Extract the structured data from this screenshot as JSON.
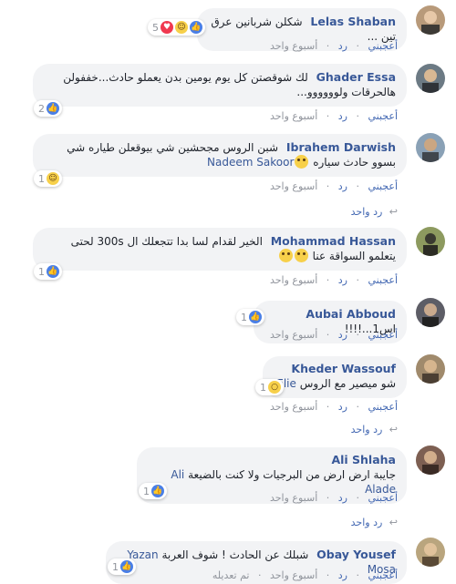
{
  "accent": "#385898",
  "link_color": "#4267b2",
  "actions": {
    "like": "أعجبني",
    "reply": "رد",
    "dot": "·",
    "edited": "تم تعديله"
  },
  "comments": [
    {
      "name": "Lelas Shaban",
      "text": "شكلن شربانين عرق تين ...",
      "time": "أسبوع واحد",
      "reactions": [
        "like",
        "haha",
        "love"
      ],
      "count": "5"
    },
    {
      "name": "Ghader Essa",
      "text": "لك شوقصتن كل يوم يومين بدن يعملو حادث...خففولن هالحرقات ولوووووو...",
      "time": "أسبوع واحد",
      "reactions": [
        "like"
      ],
      "count": "2"
    },
    {
      "name": "Ibrahem Darwish",
      "text": "شبن الروس مجحشين شي بيوقعلن طياره شي بسوو حادث سياره",
      "tag": "Nadeem Sakoor",
      "time": "أسبوع واحد",
      "reactions": [
        "haha"
      ],
      "count": "1",
      "reply_label": "رد واحد"
    },
    {
      "name": "Mohammad Hassan",
      "text": "الخير لقدام لسا بدا تتجعلك ال 300s لحتى يتعلمو السواقة عنا",
      "time": "أسبوع واحد",
      "reactions": [
        "like"
      ],
      "count": "1"
    },
    {
      "name": "Aubai Abboud",
      "text": "اس1...!!!!",
      "time": "أسبوع واحد",
      "reactions": [
        "like"
      ],
      "count": "1"
    },
    {
      "name": "Kheder Wassouf",
      "text": "شو ميصير مع الروس",
      "tag": "Elie",
      "time": "أسبوع واحد",
      "reactions": [
        "wow"
      ],
      "count": "1",
      "reply_label": "رد واحد"
    },
    {
      "name": "Ali Shlaha",
      "text": "جايبة ارض ارض من البرجيات ولا كنت بالضيعة",
      "tag": "Ali Alade",
      "time": "أسبوع واحد",
      "reactions": [
        "like"
      ],
      "count": "1",
      "reply_label": "رد واحد"
    },
    {
      "name": "Obay Yousef",
      "text": "شبلك عن الحادث ! شوف العربة",
      "tag": "Yazan Mosa",
      "time": "أسبوع واحد",
      "reactions": [
        "like"
      ],
      "count": "1"
    }
  ]
}
